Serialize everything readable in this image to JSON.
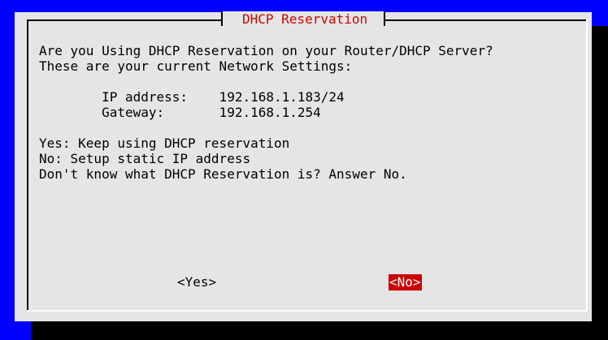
{
  "dialog": {
    "title": "DHCP Reservation",
    "lines": {
      "question": "Are you Using DHCP Reservation on your Router/DHCP Server?",
      "intro": "These are your current Network Settings:",
      "ip": "        IP address:    192.168.1.183/24",
      "gateway": "        Gateway:       192.168.1.254",
      "yes_help": "Yes: Keep using DHCP reservation",
      "no_help": "No: Setup static IP address",
      "dont_know": "Don't know what DHCP Reservation is? Answer No."
    },
    "buttons": {
      "yes": "<Yes>",
      "no": "<No>"
    },
    "colors": {
      "background": "#0000ff",
      "dialog": "#e5e5e5",
      "title": "#cc0000",
      "selected_button": "#cc0000"
    }
  }
}
